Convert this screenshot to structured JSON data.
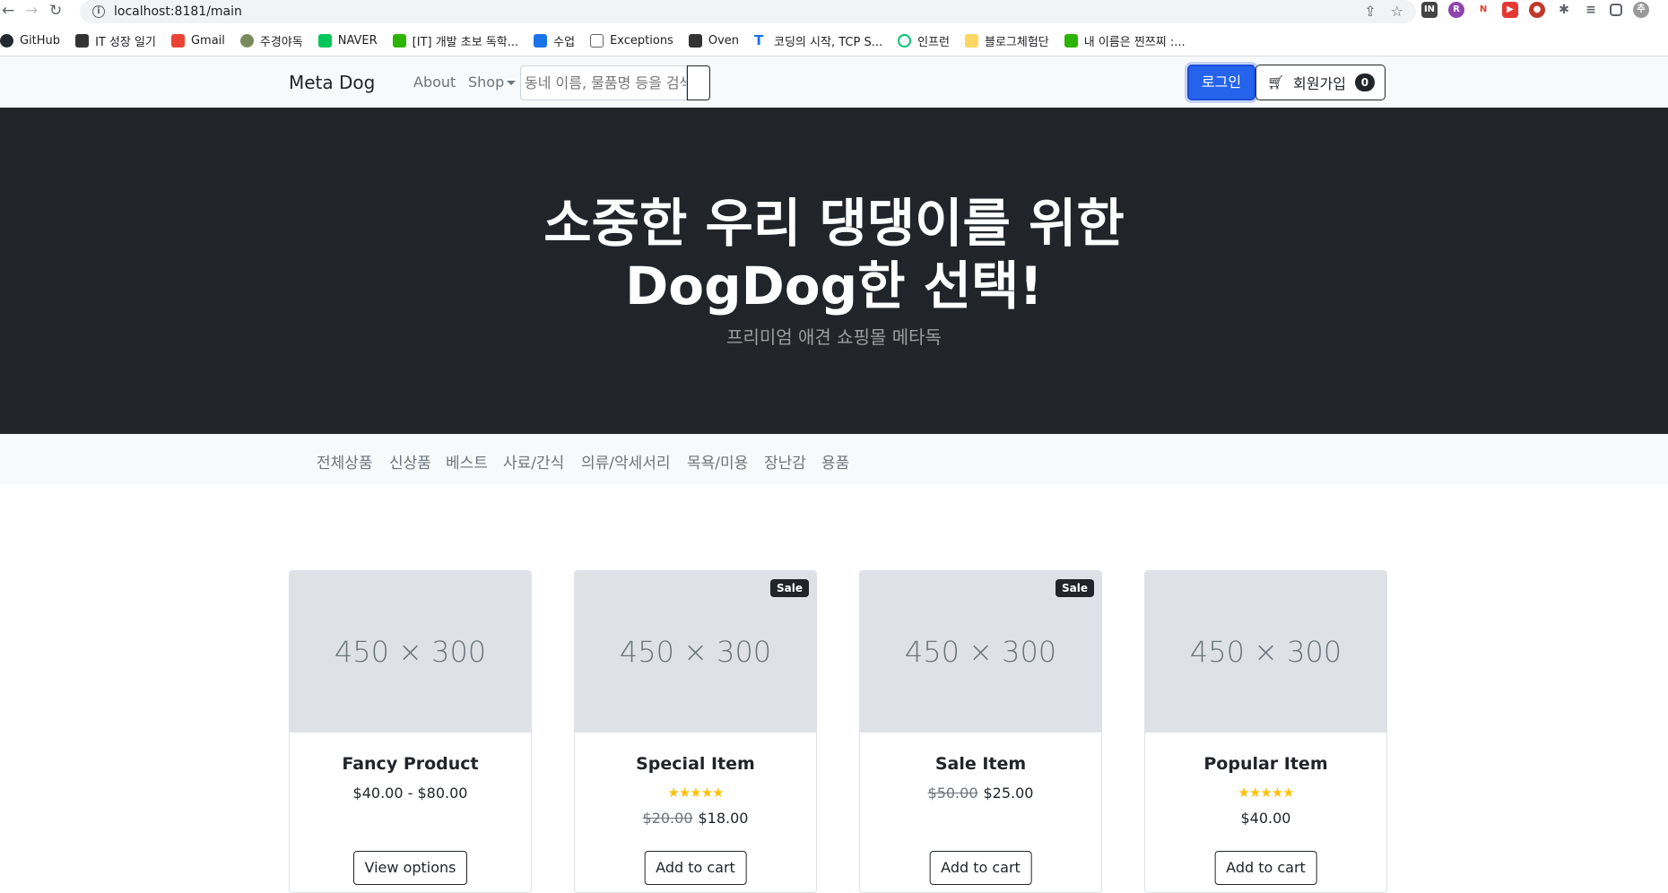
{
  "browser": {
    "url": "localhost:8181/main",
    "bookmarks": [
      "GitHub",
      "IT 성장 일기",
      "Gmail",
      "주경야독",
      "NAVER",
      "[IT] 개발 초보 독학...",
      "수업",
      "Exceptions",
      "Oven",
      "코딩의 시작, TCP S...",
      "인프런",
      "블로그체험단",
      "내 이름은 찐쯔찌 :..."
    ]
  },
  "navbar": {
    "brand": "Meta Dog",
    "about": "About",
    "shop": "Shop",
    "search_placeholder": "동네 이름, 물품명 등을 검색해보세요!",
    "login": "로그인",
    "signup": "회원가입",
    "cart_count": "0"
  },
  "hero": {
    "title_line1": "소중한 우리 댕댕이를 위한",
    "title_line2": "DogDog한 선택!",
    "subtitle": "프리미엄 애견 쇼핑몰 메타독"
  },
  "categories": [
    "전체상품",
    "신상품",
    "베스트",
    "사료/간식",
    "의류/악세서리",
    "목욕/미용",
    "장난감",
    "용품"
  ],
  "products": [
    {
      "image": "450 × 300",
      "badge": "",
      "title": "Fancy Product",
      "rating": 0,
      "old_price": "",
      "price": "$40.00 - $80.00",
      "button": "View options"
    },
    {
      "image": "450 × 300",
      "badge": "Sale",
      "title": "Special Item",
      "rating": 5,
      "old_price": "$20.00",
      "price": "$18.00",
      "button": "Add to cart"
    },
    {
      "image": "450 × 300",
      "badge": "Sale",
      "title": "Sale Item",
      "rating": 0,
      "old_price": "$50.00",
      "price": "$25.00",
      "button": "Add to cart"
    },
    {
      "image": "450 × 300",
      "badge": "",
      "title": "Popular Item",
      "rating": 5,
      "old_price": "",
      "price": "$40.00",
      "button": "Add to cart"
    }
  ],
  "colors": {
    "primary": "#2563eb",
    "dark": "#212529",
    "light": "#f8f9fa",
    "star": "#ffc107"
  }
}
